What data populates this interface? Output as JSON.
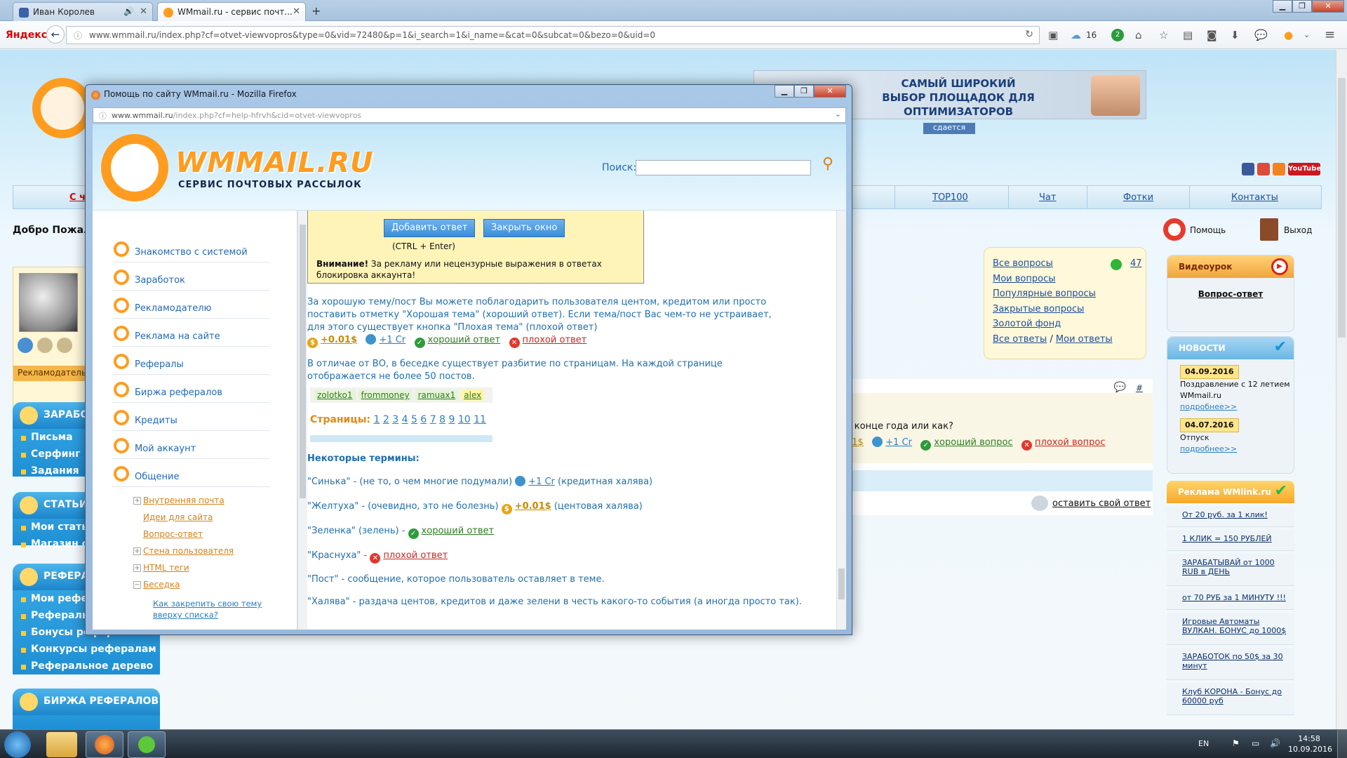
{
  "browser": {
    "tabs": [
      {
        "label": "Иван Королев",
        "has_sound": true
      },
      {
        "label": "WMmail.ru - сервис почт...",
        "active": true
      }
    ],
    "new_tab": "+",
    "yandex_logo": "Яндекс",
    "url": "www.wmmail.ru/index.php?cf=otvet-viewvopros&type=0&vid=72480&p=1&i_search=1&i_name=&cat=0&subcat=0&bezo=0&uid=0",
    "weather": "16",
    "badge_count": "2",
    "window_controls": [
      "minimize",
      "maximize",
      "close"
    ]
  },
  "page": {
    "banner_text": "САМЫЙ ШИРОКИЙ ВЫБОР ПЛОЩАДОК ДЛЯ ОПТИМИЗАТОРОВ",
    "banner_sub": "сдается",
    "menu": [
      "С ч",
      "ТОР100",
      "Чат",
      "Фотки",
      "Контакты"
    ],
    "welcome": "Добро Пожал",
    "help_label": "Помощь",
    "exit_label": "Выход",
    "advertiser_label": "Рекламодатель",
    "left_sections": [
      {
        "title": "ЗАРАБО",
        "items": [
          "Письма",
          "Серфинг",
          "Задания"
        ]
      },
      {
        "title": "СТАТЬИ",
        "items": [
          "Мои стать",
          "Магазин ст"
        ]
      },
      {
        "title": "РЕФЕРА",
        "items": [
          "Мои рефе",
          "Рефералы",
          "Бонусы рефералам",
          "Конкурсы рефералам",
          "Реферальное дерево"
        ]
      },
      {
        "title": "БИРЖА РЕФЕРАЛОВ",
        "items": []
      }
    ],
    "questions_box": {
      "links": [
        "Все вопросы",
        "Мои вопросы",
        "Популярные вопросы",
        "Закрытые вопросы",
        "Золотой фонд",
        "Все ответы",
        "Мои ответы"
      ],
      "count": "47",
      "separator": "/"
    },
    "question_fragment": "в конце года или как?",
    "question_actions": {
      "cent": "01$",
      "credit": "+1 Cr",
      "good": "хороший вопрос",
      "bad": "плохой вопрос"
    },
    "hash": "#",
    "leave_answer": "оставить свой ответ",
    "video_box": {
      "title": "Видеоурок",
      "link": "Вопрос-ответ"
    },
    "news": {
      "title": "НОВОСТИ",
      "items": [
        {
          "date": "04.09.2016",
          "text": "Поздравление с 12 летием WMmail.ru",
          "more": "подробнее>>"
        },
        {
          "date": "04.07.2016",
          "text": "Отпуск",
          "more": "подробнее>>"
        }
      ]
    },
    "wmlink": {
      "title": "Реклама WMlink.ru",
      "items": [
        "От 20 руб. за 1 клик!",
        "1 КЛИК = 150 РУБЛЕЙ",
        "ЗАРАБАТЫВАЙ от 1000 RUB в ДЕНЬ",
        "от 70 РУБ за 1 МИНУТУ !!!",
        "Игровые Автоматы ВУЛКАН. БОНУС до 1000$",
        "ЗАРАБОТОК по 50$ за 30 минут",
        "Клуб КОРОНА - Бонус до 60000 руб"
      ]
    }
  },
  "popup": {
    "title": "Помощь по сайту WMmail.ru - Mozilla Firefox",
    "url_host": "www.wmmail.ru",
    "url_rest": "/index.php?cf=help-hfrvh&cid=otvet-viewvopros",
    "logo_text": "WMMAIL.RU",
    "logo_sub": "СЕРВИС ПОЧТОВЫХ РАССЫЛОК",
    "search_label": "Поиск:",
    "nav": [
      "Знакомство с системой",
      "Заработок",
      "Рекламодателю",
      "Реклама на сайте",
      "Рефералы",
      "Биржа рефералов",
      "Кредиты",
      "Мой аккаунт",
      "Общение"
    ],
    "subnav": [
      "Внутренняя почта",
      "Идеи для сайта",
      "Вопрос-ответ",
      "Стена пользователя",
      "HTML теги",
      "Беседка"
    ],
    "subsub": "Как закрепить свою тему вверху списка?",
    "btn_add": "Добавить ответ",
    "btn_close": "Закрыть окно",
    "shortcut": "(CTRL + Enter)",
    "warning_bold": "Внимание!",
    "warning_text": "За рекламу или нецензурные выражения в ответах блокировка аккаунта!",
    "para1": "За хорошую тему/пост Вы можете поблагодарить пользователя центом, кредитом или просто поставить отметку \"Хорошая тема\" (хороший ответ). Если тема/пост Вас чем-то не устраивает, для этого существует кнопка \"Плохая тема\" (плохой ответ)",
    "actions": {
      "cent": "+0.01$",
      "credit": "+1 Cr",
      "good": "хороший ответ",
      "bad": "плохой ответ"
    },
    "para2": "В отличае от ВО, в беседке существует разбитие по страницам. На каждой странице отображается не более 50 постов.",
    "tags": [
      "zolotko1",
      "frommoney",
      "ramuax1",
      "alex"
    ],
    "pages_label": "Страницы:",
    "pages": [
      "1",
      "2",
      "3",
      "4",
      "5",
      "6",
      "7",
      "8",
      "9",
      "10",
      "11"
    ],
    "terms_title": "Некоторые термины",
    "terms": [
      {
        "term": "\"Синька\"",
        "desc": " - (не то, о чем многие подумали) ",
        "link": "+1 Cr",
        "after": " (кредитная халява)",
        "icon": "cr"
      },
      {
        "term": "\"Желтуха\"",
        "desc": " - (очевидно, это не болезнь) ",
        "link": "+0.01$",
        "after": " (центовая халява)",
        "icon": "coin"
      },
      {
        "term": "\"Зеленка\"",
        "desc": " (зелень) - ",
        "link": "хороший ответ",
        "after": "",
        "icon": "ok"
      },
      {
        "term": "\"Краснуха\"",
        "desc": " - ",
        "link": "плохой ответ",
        "after": "",
        "icon": "bad"
      },
      {
        "term": "\"Пост\"",
        "desc": " - сообщение, которое пользователь оставляет в теме.",
        "link": "",
        "after": "",
        "icon": ""
      },
      {
        "term": "\"Халява\"",
        "desc": " - раздача центов, кредитов и даже зелени в честь какого-то события (а иногда просто так).",
        "link": "",
        "after": "",
        "icon": ""
      }
    ]
  },
  "taskbar": {
    "lang": "EN",
    "time": "14:58",
    "date": "10.09.2016"
  },
  "colors": {
    "accent_orange": "#ff9c1f",
    "link_blue": "#1a4fa0",
    "sidebar_blue": "#2a9ddd",
    "good_green": "#2e9b3a",
    "bad_red": "#e0382b"
  }
}
